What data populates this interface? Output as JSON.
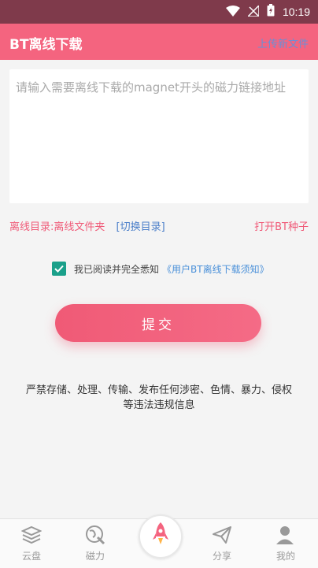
{
  "status_bar": {
    "time": "10:19"
  },
  "app_bar": {
    "title": "BT离线下载",
    "action": "上传新文件"
  },
  "input": {
    "placeholder": "请输入需要离线下载的magnet开头的磁力链接地址"
  },
  "directory": {
    "label": "离线目录:离线文件夹",
    "switch": "[切换目录]",
    "open_bt": "打开BT种子"
  },
  "agreement": {
    "text": "我已阅读并完全悉知",
    "link": "《用户BT离线下载须知》",
    "checked": true
  },
  "submit": {
    "label": "提交"
  },
  "notice": {
    "line1": "严禁存储、处理、传输、发布任何涉密、色情、暴力、侵权",
    "line2": "等违法违规信息"
  },
  "bottom_nav": {
    "items": [
      {
        "label": "云盘",
        "icon": "layers-icon"
      },
      {
        "label": "磁力",
        "icon": "magnet-globe-icon"
      },
      {
        "label": "",
        "icon": "rocket-icon"
      },
      {
        "label": "分享",
        "icon": "paper-plane-icon"
      },
      {
        "label": "我的",
        "icon": "user-icon"
      }
    ]
  },
  "colors": {
    "accent": "#f4647f",
    "status_bar": "#7f3a4b",
    "checkbox": "#1aa08a",
    "link": "#4a90d9"
  }
}
